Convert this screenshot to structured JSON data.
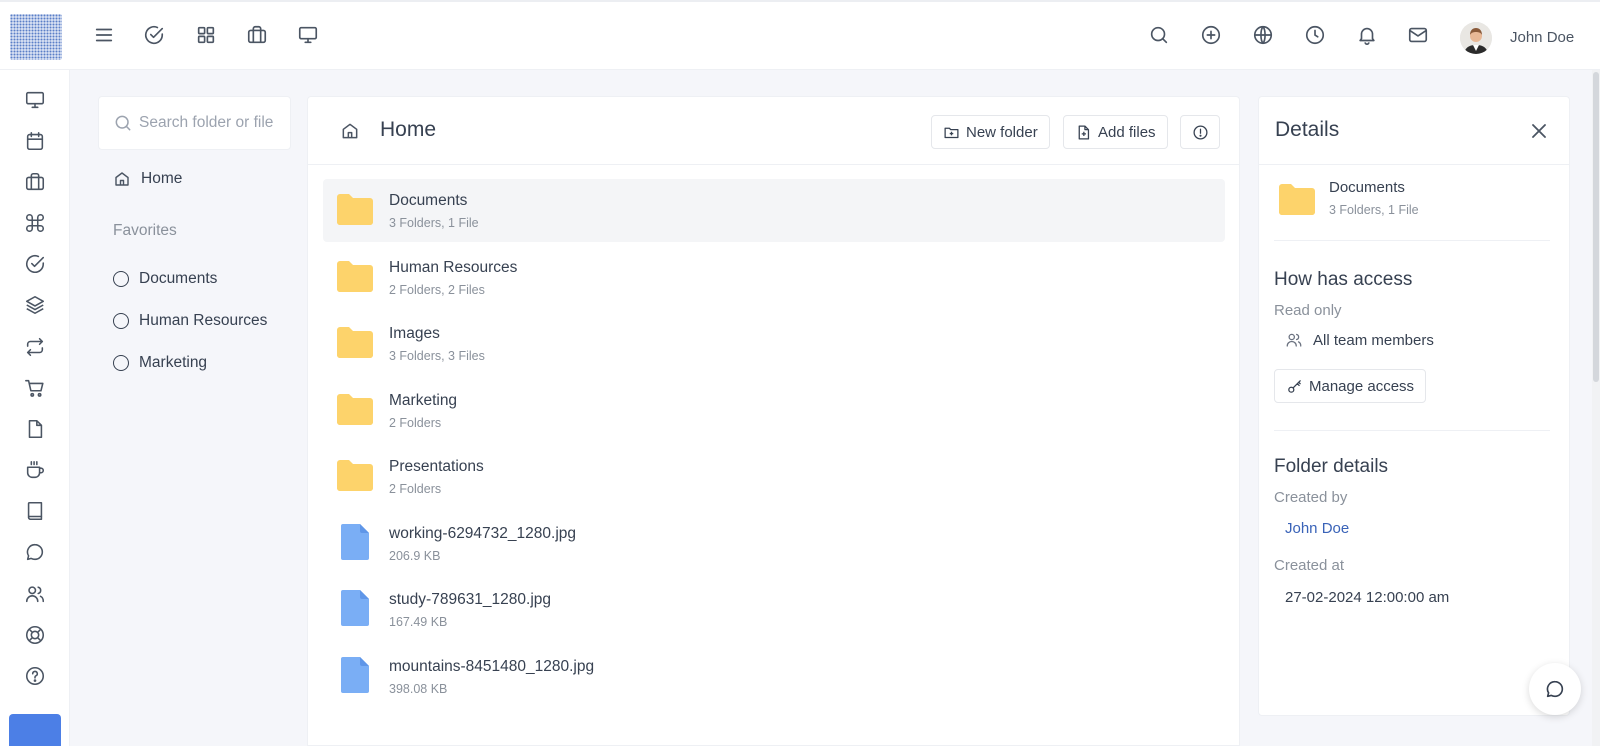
{
  "user": {
    "name": "John Doe"
  },
  "topbar": {
    "left_icons": [
      "menu-icon",
      "check-circle-icon",
      "grid-icon",
      "briefcase-icon",
      "monitor-icon"
    ],
    "right_icons": [
      "search-icon",
      "plus-circle-icon",
      "globe-icon",
      "clock-icon",
      "bell-icon",
      "mail-icon"
    ]
  },
  "rail": {
    "icons": [
      "monitor-icon",
      "calendar-icon",
      "briefcase-icon",
      "command-icon",
      "check-circle-icon",
      "layers-icon",
      "repeat-icon",
      "cart-icon",
      "file-icon",
      "coffee-icon",
      "book-icon",
      "chat-icon",
      "users-icon",
      "lifebuoy-icon",
      "help-icon"
    ]
  },
  "folder_nav": {
    "search_placeholder": "Search folder or file",
    "home_label": "Home",
    "favorites_title": "Favorites",
    "favorites": [
      {
        "label": "Documents"
      },
      {
        "label": "Human Resources"
      },
      {
        "label": "Marketing"
      }
    ]
  },
  "main": {
    "title": "Home",
    "new_folder_label": "New folder",
    "add_files_label": "Add files",
    "items": [
      {
        "type": "folder",
        "name": "Documents",
        "meta": "3 Folders, 1 File",
        "selected": true
      },
      {
        "type": "folder",
        "name": "Human Resources",
        "meta": "2 Folders, 2 Files"
      },
      {
        "type": "folder",
        "name": "Images",
        "meta": "3 Folders, 3 Files"
      },
      {
        "type": "folder",
        "name": "Marketing",
        "meta": "2 Folders"
      },
      {
        "type": "folder",
        "name": "Presentations",
        "meta": "2 Folders"
      },
      {
        "type": "file",
        "name": "working-6294732_1280.jpg",
        "meta": "206.9 KB"
      },
      {
        "type": "file",
        "name": "study-789631_1280.jpg",
        "meta": "167.49 KB"
      },
      {
        "type": "file",
        "name": "mountains-8451480_1280.jpg",
        "meta": "398.08 KB"
      }
    ]
  },
  "details": {
    "title": "Details",
    "selected_name": "Documents",
    "selected_meta": "3 Folders, 1 File",
    "access_heading": "How has access",
    "access_level": "Read only",
    "access_group": "All team members",
    "manage_label": "Manage access",
    "folder_details_heading": "Folder details",
    "created_by_label": "Created by",
    "created_by": "John Doe",
    "created_at_label": "Created at",
    "created_at": "27-02-2024 12:00:00 am"
  },
  "colors": {
    "folder": "#fdd36b",
    "file": "#7aaef5",
    "link": "#3a63b8",
    "primary": "#4c7fe6"
  }
}
